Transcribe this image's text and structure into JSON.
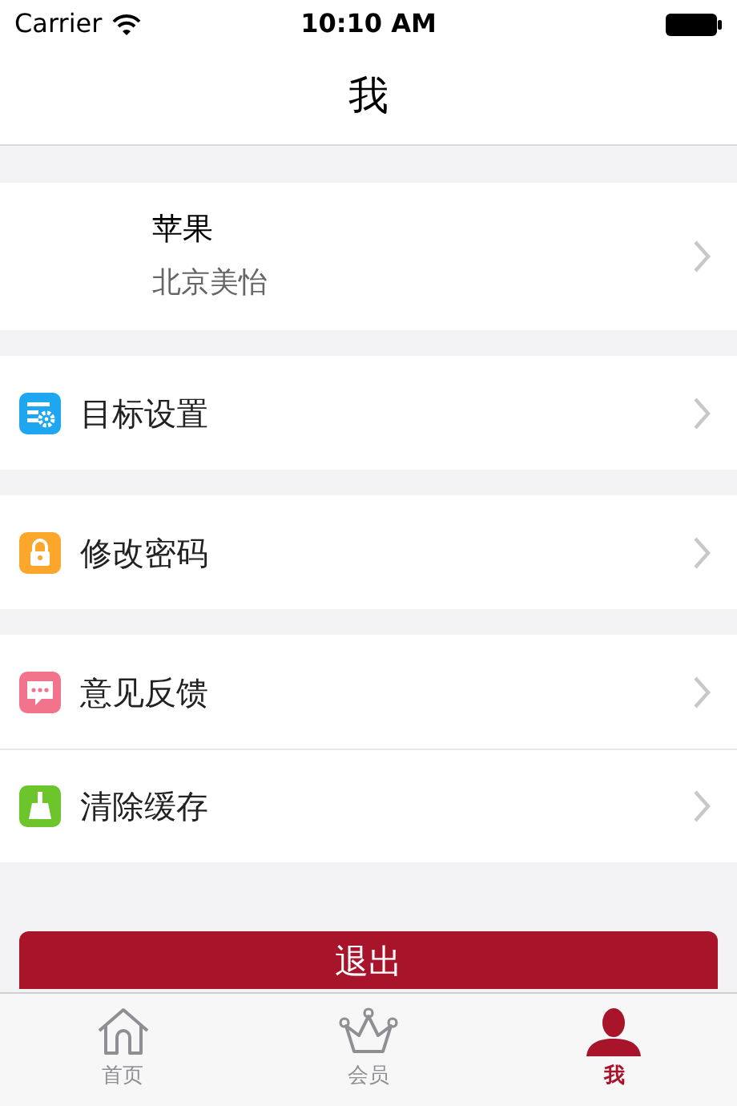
{
  "status_bar": {
    "carrier": "Carrier",
    "time": "10:10 AM"
  },
  "nav": {
    "title": "我"
  },
  "profile": {
    "name": "苹果",
    "subtitle": "北京美怡"
  },
  "sections": [
    [
      {
        "label": "目标设置",
        "kind": "settings"
      }
    ],
    [
      {
        "label": "修改密码",
        "kind": "lock"
      }
    ],
    [
      {
        "label": "意见反馈",
        "kind": "feedback"
      },
      {
        "label": "清除缓存",
        "kind": "broom"
      }
    ]
  ],
  "logout": {
    "label": "退出"
  },
  "tabs": [
    {
      "label": "首页",
      "kind": "home",
      "selected": false
    },
    {
      "label": "会员",
      "kind": "crown",
      "selected": false
    },
    {
      "label": "我",
      "kind": "person",
      "selected": true
    }
  ]
}
